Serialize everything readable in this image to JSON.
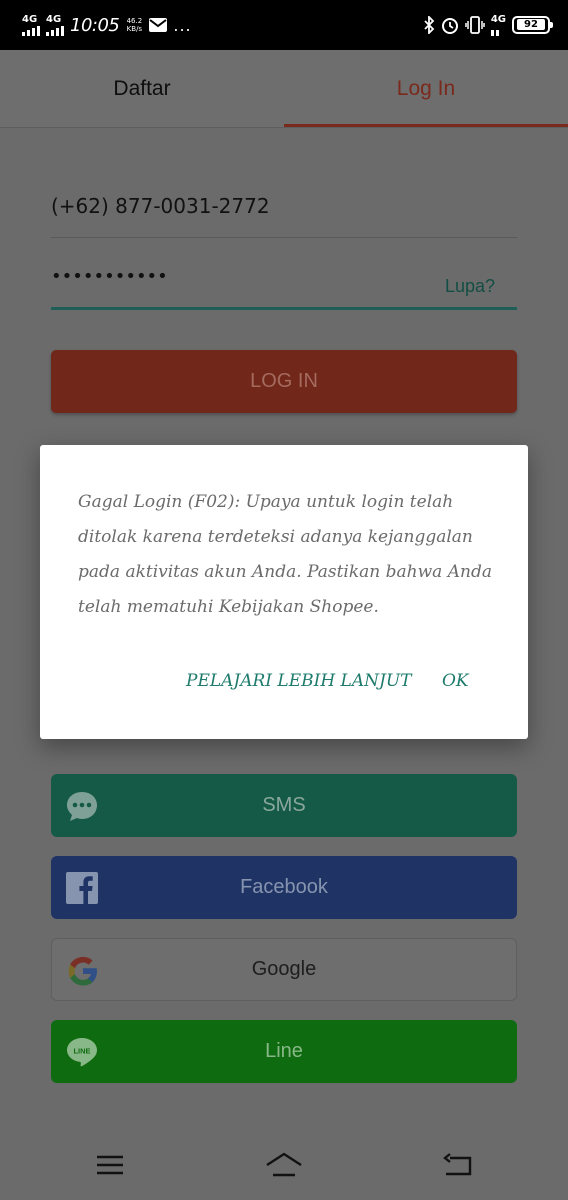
{
  "status_bar": {
    "sim1": "4G",
    "sim2": "4G",
    "time": "10:05",
    "speed_value": "46.2",
    "speed_unit": "KB/s",
    "more": "...",
    "network": "4G",
    "battery": "92"
  },
  "tabs": [
    {
      "label": "Daftar",
      "active": false
    },
    {
      "label": "Log In",
      "active": true
    }
  ],
  "form": {
    "phone_value": "(+62) 877-0031-2772",
    "password_value": "•••••••••••",
    "forgot_label": "Lupa?",
    "login_button": "LOG IN"
  },
  "social": {
    "sms": "SMS",
    "facebook": "Facebook",
    "google": "Google",
    "line": "Line"
  },
  "dialog": {
    "message": "Gagal Login (F02): Upaya untuk login telah ditolak karena terdeteksi adanya kejanggalan pada aktivitas akun Anda. Pastikan bahwa Anda telah mematuhi Kebijakan Shopee.",
    "learn_more": "PELAJARI LEBIH LANJUT",
    "ok": "OK"
  },
  "colors": {
    "accent": "#ee4d2d",
    "teal": "#00bfa5",
    "sms": "#26aa85",
    "facebook": "#3b5998",
    "line": "#00b900"
  }
}
